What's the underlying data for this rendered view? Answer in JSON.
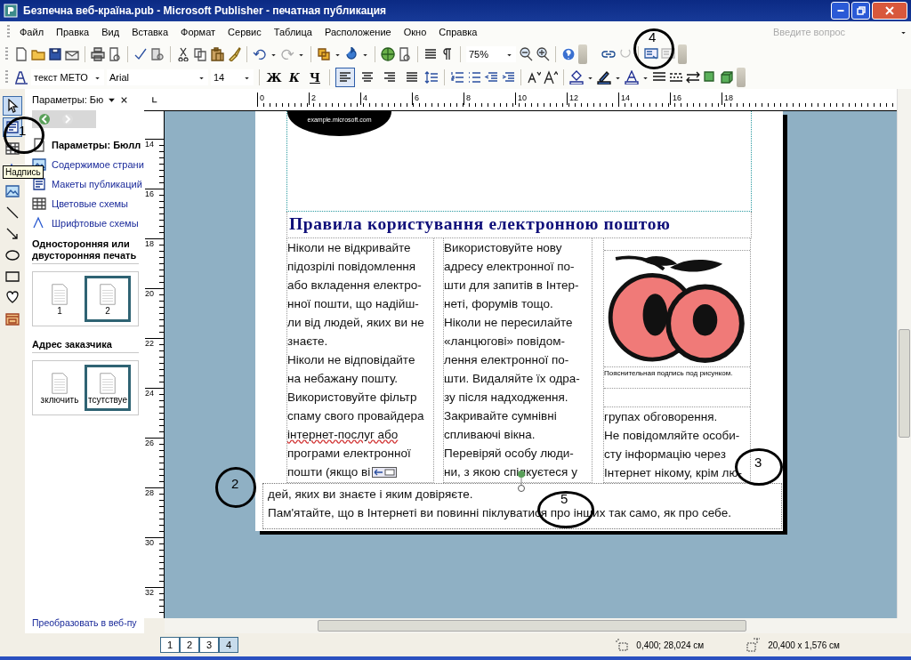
{
  "window": {
    "title": "Безпечна веб-країна.pub - Microsoft Publisher - печатная публикация"
  },
  "menu": [
    {
      "label": "Файл"
    },
    {
      "label": "Правка"
    },
    {
      "label": "Вид"
    },
    {
      "label": "Вставка"
    },
    {
      "label": "Формат"
    },
    {
      "label": "Сервис"
    },
    {
      "label": "Таблица"
    },
    {
      "label": "Расположение"
    },
    {
      "label": "Окно"
    },
    {
      "label": "Справка"
    }
  ],
  "help_box": {
    "placeholder": "Введите вопрос"
  },
  "standard_toolbar": {
    "zoom": "75%"
  },
  "formatting_toolbar": {
    "style": "текст МЕТО",
    "font": "Arial",
    "size": "14",
    "bold": "Ж",
    "italic": "К",
    "underline": "Ч",
    "align": [
      {
        "selected": true
      },
      {
        "selected": false
      },
      {
        "selected": false
      },
      {
        "selected": false
      }
    ]
  },
  "tools": [
    {
      "kind": "pointer",
      "selected": true
    },
    {
      "kind": "textbox",
      "selected": true
    },
    {
      "kind": "table",
      "selected": false
    },
    {
      "kind": "wordart",
      "selected": false
    },
    {
      "kind": "picture",
      "selected": false
    },
    {
      "kind": "line",
      "selected": false
    },
    {
      "kind": "arrow",
      "selected": false
    },
    {
      "kind": "oval",
      "selected": false
    },
    {
      "kind": "rectangle",
      "selected": false
    },
    {
      "kind": "shapes",
      "selected": false
    },
    {
      "kind": "gallery",
      "selected": false
    }
  ],
  "tooltip": "Надпись",
  "task_pane": {
    "title": "Параметры: Бю",
    "items": [
      {
        "kind": "header",
        "label": "Параметры: Бюлл"
      },
      {
        "kind": "content",
        "label": "Содержимое страни"
      },
      {
        "kind": "layouts",
        "label": "Макеты публикаций"
      },
      {
        "kind": "colors",
        "label": "Цветовые схемы"
      },
      {
        "kind": "fonts",
        "label": "Шрифтовые схемы"
      }
    ],
    "sections": [
      {
        "title": "Односторонняя или двусторонняя печать",
        "options": [
          {
            "label": "1",
            "selected": false
          },
          {
            "label": "2",
            "selected": true
          }
        ]
      },
      {
        "title": "Адрес заказчика",
        "options": [
          {
            "label": "зключить",
            "selected": false
          },
          {
            "label": "тсутствуе",
            "selected": true
          }
        ]
      }
    ],
    "footer_link": "Преобразовать в веб-пу"
  },
  "rulers": {
    "horizontal": [
      "0",
      "2",
      "4",
      "6",
      "8",
      "10",
      "12",
      "14",
      "16",
      "18"
    ],
    "vertical": [
      "14",
      "16",
      "18",
      "20",
      "22",
      "24",
      "26",
      "28",
      "30",
      "32"
    ]
  },
  "page": {
    "url_badge": "example.microsoft.com",
    "heading": "Правила користування електронною поштою",
    "column_1": [
      "Ніколи не відкривайте",
      "підозрілі повідомлення",
      "або вкладення електро-",
      "нної пошти, що надійш-",
      "ли від людей, яких ви не",
      "знаєте.",
      " Ніколи не відповідайте",
      "на небажану пошту.",
      "Використовуйте фільтр",
      "спаму свого провайдера",
      "інтернет-послуг або",
      "програми електронної",
      "пошти (якщо ві"
    ],
    "column_2": [
      " Використовуйте нову",
      "адресу електронної по-",
      "шти для запитів в Інтер-",
      "неті, форумів тощо.",
      "Ніколи не пересилайте",
      "«ланцюгові» повідом-",
      "лення електронної по-",
      "шти. Видаляйте їх одра-",
      "зу після надходження.",
      "Закривайте сумнівні",
      "спливаючі вікна.",
      "Перевіряй особу люди-",
      "ни, з якою спілкуєтеся у"
    ],
    "caption": "Пояснительная подпись под рисунком.",
    "column_3": [
      "групах обговорення.",
      "Не повідомляйте особи-",
      "сту інформацію через",
      "Інтернет нікому, крім лю-"
    ],
    "bottom_text": [
      "дей, яких ви знаєте і яким довіряєте.",
      "Пам'ятайте, що в Інтернеті ви повинні піклуватися про інших так само, як про себе."
    ]
  },
  "page_tabs": [
    {
      "label": "1",
      "selected": false
    },
    {
      "label": "2",
      "selected": false
    },
    {
      "label": "3",
      "selected": false
    },
    {
      "label": "4",
      "selected": true
    }
  ],
  "status_bar": {
    "position": "0,400; 28,024 см",
    "size": "20,400 x  1,576 см"
  },
  "annotations": [
    {
      "label": "1"
    },
    {
      "label": "4"
    },
    {
      "label": "2"
    },
    {
      "label": "3"
    },
    {
      "label": "5"
    }
  ]
}
